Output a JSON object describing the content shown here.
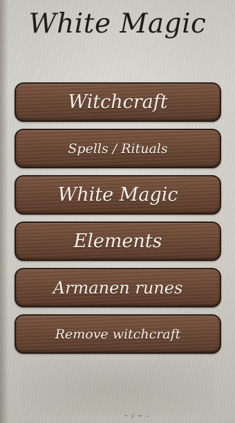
{
  "header": {
    "title": "White Magic"
  },
  "menu": {
    "items": [
      {
        "label": "Witchcraft"
      },
      {
        "label": "Spells / Rituals"
      },
      {
        "label": "White Magic"
      },
      {
        "label": "Elements"
      },
      {
        "label": "Armanen runes"
      },
      {
        "label": "Remove witchcraft"
      }
    ]
  },
  "colors": {
    "background": "#cfcdc6",
    "button_wood": "#6b4835",
    "button_text": "#f4efe8",
    "title_text": "#1f1c18"
  }
}
